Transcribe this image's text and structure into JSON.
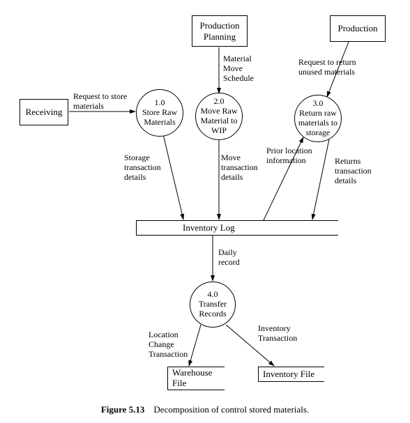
{
  "entities": {
    "receiving": "Receiving",
    "production_planning": "Production\nPlanning",
    "production": "Production"
  },
  "processes": {
    "p1": {
      "id": "1.0",
      "name": "Store\nRaw\nMaterials"
    },
    "p2": {
      "id": "2.0",
      "name": "Move Raw\nMaterial to\nWIP"
    },
    "p3": {
      "id": "3.0",
      "name": "Return raw\nmaterials to\nstorage"
    },
    "p4": {
      "id": "4.0",
      "name": "Transfer\nRecords"
    }
  },
  "datastores": {
    "inventory_log": "Inventory Log",
    "warehouse_file": "Warehouse\nFile",
    "inventory_file": "Inventory File"
  },
  "flows": {
    "request_store": "Request to store\nmaterials",
    "material_move_schedule": "Material\nMove\nSchedule",
    "request_return": "Request to return\nunused materials",
    "storage_txn": "Storage\ntransaction\ndetails",
    "move_txn": "Move\ntransaction\ndetails",
    "prior_location": "Prior location\ninformation",
    "returns_txn": "Returns\ntransaction\ndetails",
    "daily_record": "Daily\nrecord",
    "location_change_txn": "Location\nChange\nTransaction",
    "inventory_txn": "Inventory\nTransaction"
  },
  "caption": {
    "num": "Figure 5.13",
    "text": "Decomposition of control stored materials."
  }
}
